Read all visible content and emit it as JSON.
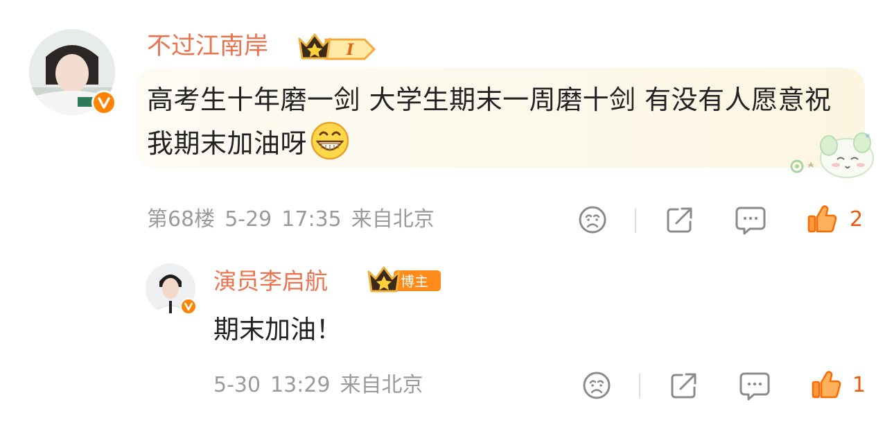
{
  "comment": {
    "username": "不过江南岸",
    "level_badge": "I",
    "text": "高考生十年磨一剑 大学生期末一周磨十剑 有没有人愿意祝我期末加油呀",
    "emoji": "grinning-face-icon",
    "floor": "第68楼",
    "date": "5-29",
    "time": "17:35",
    "location": "来自北京",
    "like_count": "2"
  },
  "reply": {
    "username": "演员李启航",
    "role_badge": "博主",
    "text": "期末加油！",
    "date": "5-30",
    "time": "13:29",
    "location": "来自北京",
    "like_count": "1"
  },
  "colors": {
    "username": "#eb7350",
    "verified_badge": "#ff8200",
    "like_active": "#ff6a00",
    "meta_text": "#9a9a9a",
    "icon_gray": "#8a8a8a"
  }
}
